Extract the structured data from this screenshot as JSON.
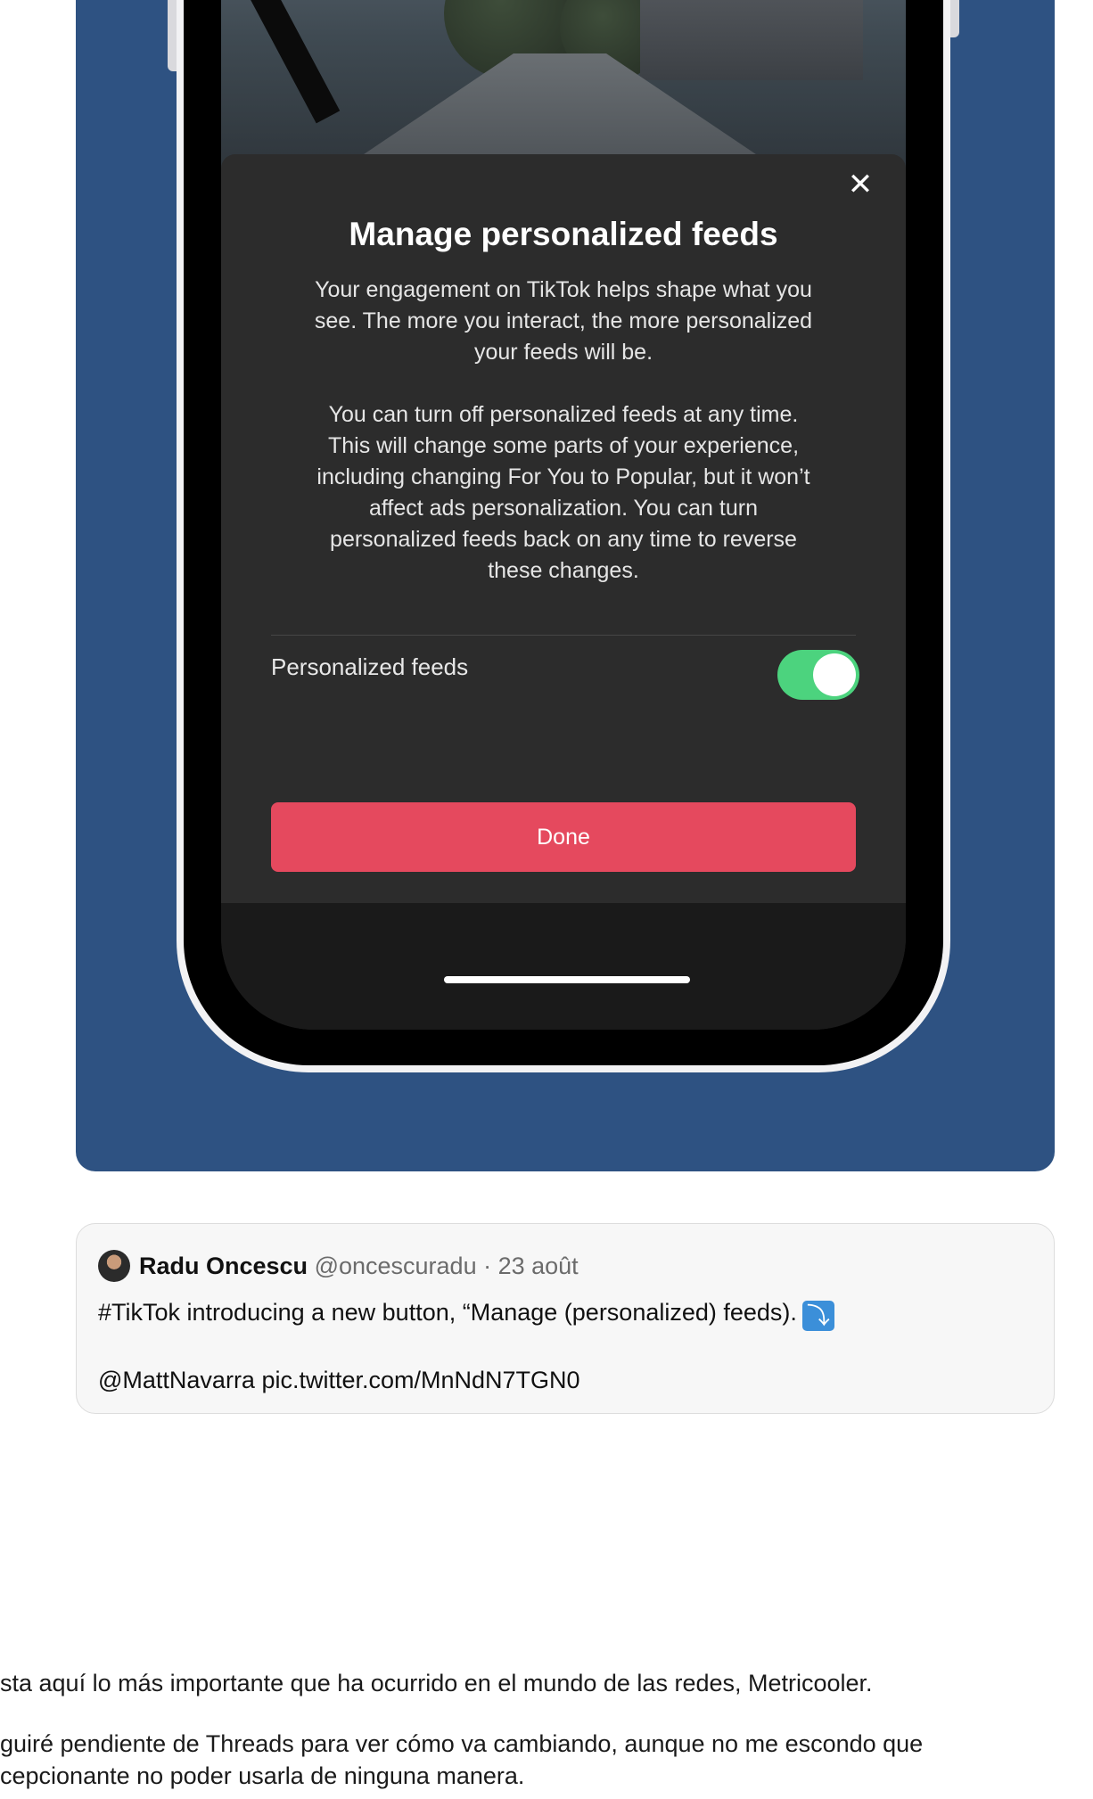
{
  "modal": {
    "close_glyph": "✕",
    "title": "Manage personalized feeds",
    "paragraph1_lines": [
      "Your engagement on TikTok helps shape what you",
      "see. The more you interact, the more personalized",
      "your feeds will be."
    ],
    "paragraph2_lines": [
      "You can turn off personalized feeds at any time.",
      "This will change some parts of your experience,",
      "including changing For You to Popular, but it won’t",
      "affect ads personalization. You can turn",
      "personalized feeds back on any time to reverse",
      "these changes."
    ],
    "toggle_label": "Personalized feeds",
    "toggle_on": true,
    "toggle_color": "#4cd37e",
    "done_label": "Done",
    "done_color": "#e5495e"
  },
  "tweet": {
    "author_name": "Radu Oncescu",
    "handle_date": "@oncescuradu · 23 août",
    "text": "#TikTok introducing a new button, “Manage (personalized) feeds).",
    "arrow_icon": "arrow-down-right-icon",
    "arrow_glyph": "⤵",
    "link_text": "@MattNavarra pic.twitter.com/MnNdN7TGN0"
  },
  "article": {
    "paragraph1": "sta aquí lo más importante que ha ocurrido en el mundo de las redes, Metricooler.",
    "paragraph2_line1": "guiré pendiente de Threads para ver cómo va cambiando, aunque no me escondo que",
    "paragraph2_line2": "cepcionante no poder usarla de ninguna manera."
  },
  "colors": {
    "hero_background": "#2e5282",
    "sheet_background": "#2c2c2c"
  }
}
